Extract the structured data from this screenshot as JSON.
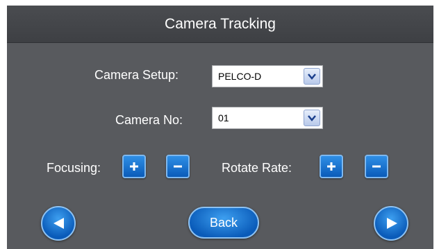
{
  "header": {
    "title": "Camera Tracking"
  },
  "camera_setup": {
    "label": "Camera Setup:",
    "value": "PELCO-D"
  },
  "camera_no": {
    "label": "Camera No:",
    "value": "01"
  },
  "focusing": {
    "label": "Focusing:"
  },
  "rotate_rate": {
    "label": "Rotate Rate:"
  },
  "navigation": {
    "back_label": "Back"
  },
  "icons": {
    "plus": "plus-icon",
    "minus": "minus-icon",
    "dropdown": "chevron-down-icon",
    "prev": "arrow-left-icon",
    "next": "arrow-right-icon"
  },
  "colors": {
    "background": "#585a5e",
    "header": "#3e4044",
    "button": "#1273d6",
    "text": "#ffffff"
  }
}
